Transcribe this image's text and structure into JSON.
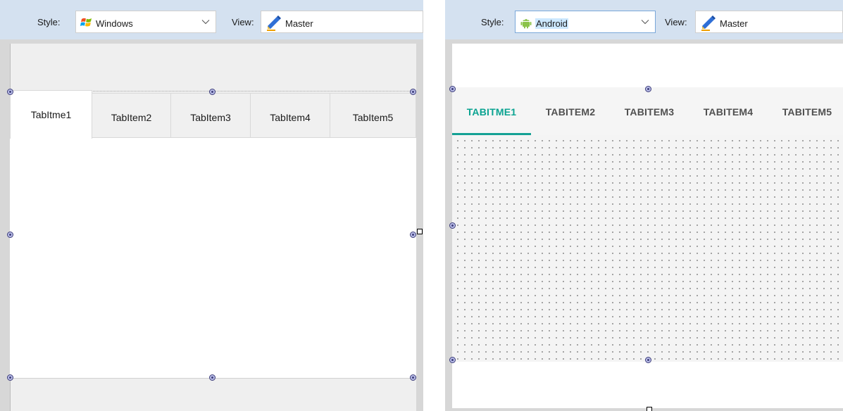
{
  "left_panel": {
    "toolbar": {
      "style_label": "Style:",
      "style_value": "Windows",
      "style_icon": "windows-logo-icon",
      "view_label": "View:",
      "view_value": "Master",
      "view_icon": "pencil-icon"
    },
    "tabs": [
      "TabItme1",
      "TabItem2",
      "TabItem3",
      "TabItem4",
      "TabItem5"
    ],
    "selected_tab_index": 0
  },
  "right_panel": {
    "toolbar": {
      "style_label": "Style:",
      "style_value": "Android",
      "style_icon": "android-icon",
      "view_label": "View:",
      "view_value": "Master",
      "view_icon": "pencil-icon"
    },
    "tabs": [
      "TABITME1",
      "TABITEM2",
      "TABITEM3",
      "TABITEM4",
      "TABITEM5"
    ],
    "selected_tab_index": 0
  },
  "colors": {
    "toolbar_bg": "#d4e1f0",
    "android_accent": "#14a194",
    "selection_highlight": "#cce8ff"
  }
}
